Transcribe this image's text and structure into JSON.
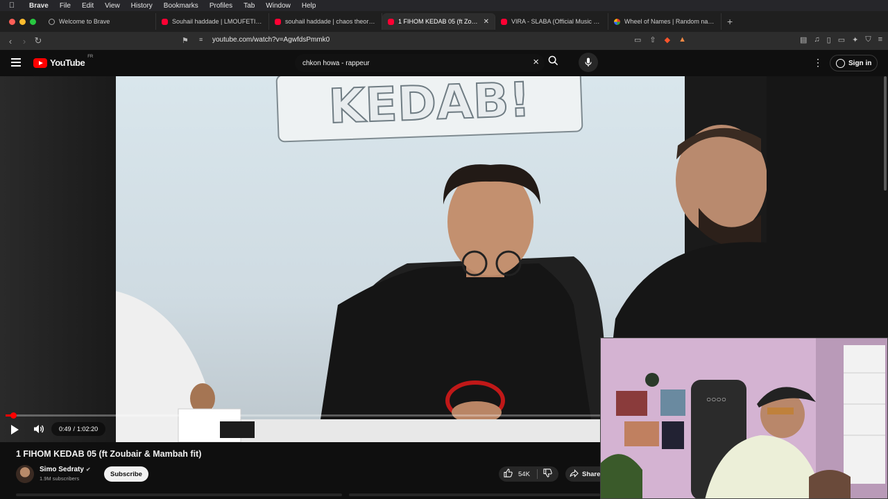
{
  "menubar": {
    "app": "Brave",
    "items": [
      "File",
      "Edit",
      "View",
      "History",
      "Bookmarks",
      "Profiles",
      "Tab",
      "Window",
      "Help"
    ]
  },
  "tabs": [
    {
      "title": "Welcome to Brave",
      "icon": "globe",
      "active": false
    },
    {
      "title": "Souhail haddade | LMOUFETICH -",
      "icon": "youtube",
      "active": false
    },
    {
      "title": "souhail haddade | chaos theory - u",
      "icon": "youtube",
      "active": false
    },
    {
      "title": "1 FIHOM KEDAB 05 (ft Zoubair",
      "icon": "youtube",
      "active": true
    },
    {
      "title": "VIRA - SLABA (Official Music Vide",
      "icon": "youtube",
      "active": false
    },
    {
      "title": "Wheel of Names | Random name p",
      "icon": "wheel",
      "active": false
    }
  ],
  "address": {
    "url": "youtube.com/watch?v=AgwfdsPmmk0"
  },
  "youtube": {
    "logo_text": "YouTube",
    "country": "FR",
    "search_value": "chkon howa - rappeur",
    "signin": "Sign in"
  },
  "video": {
    "sign_text": "KEDAB!",
    "time_current": "0:49",
    "time_separator": "/",
    "time_total": "1:02:20",
    "progress_fraction": 0.013,
    "title": "1 FIHOM KEDAB 05 (ft Zoubair & Mambah fit)",
    "channel": "Simo Sedraty",
    "subscribers": "1.9M subscribers",
    "subscribe_label": "Subscribe",
    "likes": "54K",
    "share_label": "Share"
  },
  "colors": {
    "youtube_red": "#ff0000",
    "background": "#0f0f0f"
  }
}
